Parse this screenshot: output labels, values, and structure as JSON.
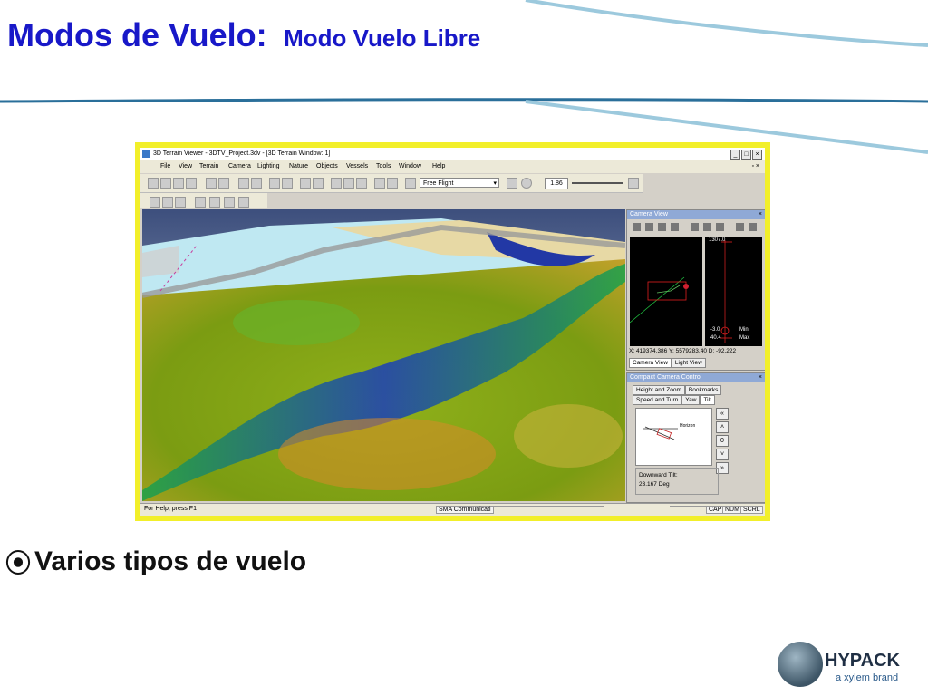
{
  "slide": {
    "title_main": "Modos de Vuelo:",
    "title_sub": "Modo Vuelo Libre",
    "bullet_mark": "⦿",
    "bullet_text": "Varios tipos de vuelo"
  },
  "logo": {
    "brand": "HYPACK",
    "tagline": "a xylem brand"
  },
  "app": {
    "window_title": "3D Terrain Viewer - 3DTV_Project.3dv - [3D Terrain Window: 1]",
    "win_buttons": [
      "_",
      "□",
      "×"
    ],
    "mdi_buttons": "_ ▫ ×",
    "menu": [
      "File",
      "View",
      "Terrain",
      "Camera",
      "Lighting",
      "Nature",
      "Objects",
      "Vessels",
      "Tools",
      "Window",
      "Help"
    ],
    "flight_mode": "Free Flight",
    "zoom_value": "1.86",
    "status": {
      "help": "For Help, press F1",
      "comm": "SMA Communicati",
      "cap": "CAP",
      "num": "NUM",
      "scrl": "SCRL"
    }
  },
  "camera_view": {
    "title": "Camera View",
    "close": "×",
    "top_value": "1307.0",
    "neg_value": "-3.0",
    "min_label": "Min",
    "low_value": "40.4",
    "max_label": "Max",
    "x_coord": "X: 419374.386",
    "y_coord": "Y: 5579283.40",
    "d_coord": "D: -92.222",
    "tabs": [
      "Camera View",
      "Light View"
    ]
  },
  "compact_control": {
    "title": "Compact Camera Control",
    "close": "×",
    "tabs_top": [
      "Height and Zoom",
      "Bookmarks"
    ],
    "tabs_bottom": [
      "Speed and Turn",
      "Yaw",
      "Tilt"
    ],
    "horizon_label": "Horizon",
    "arrow_buttons": [
      "«",
      "˄",
      "0",
      "˅",
      "»"
    ],
    "tilt_label": "Downward Tilt:",
    "tilt_value": "23.167 Deg"
  },
  "colors": {
    "title_blue": "#1818c8",
    "frame_yellow": "#f2ef2a",
    "panel_title": "#8fa9d6"
  }
}
